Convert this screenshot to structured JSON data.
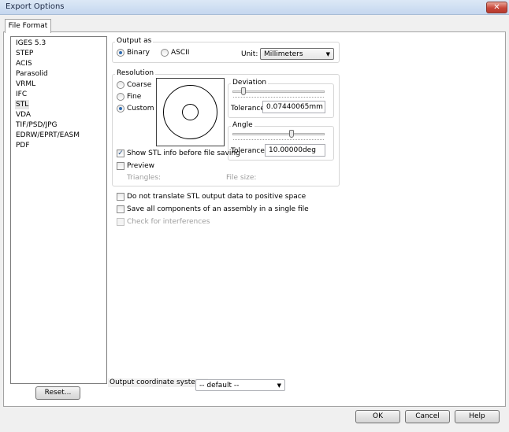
{
  "window": {
    "title": "Export Options",
    "close_glyph": "✕"
  },
  "tabs": [
    {
      "label": "File Format"
    }
  ],
  "formats": [
    {
      "label": "IGES 5.3"
    },
    {
      "label": "STEP"
    },
    {
      "label": "ACIS"
    },
    {
      "label": "Parasolid"
    },
    {
      "label": "VRML"
    },
    {
      "label": "IFC"
    },
    {
      "label": "STL"
    },
    {
      "label": "VDA"
    },
    {
      "label": "TIF/PSD/JPG"
    },
    {
      "label": "EDRW/EPRT/EASM"
    },
    {
      "label": "PDF"
    }
  ],
  "selected_format": "STL",
  "output_as": {
    "legend": "Output as",
    "binary_label": "Binary",
    "ascii_label": "ASCII",
    "selected": "Binary",
    "unit_label": "Unit:",
    "unit_value": "Millimeters"
  },
  "resolution": {
    "legend": "Resolution",
    "coarse_label": "Coarse",
    "fine_label": "Fine",
    "custom_label": "Custom",
    "selected": "Custom",
    "deviation": {
      "legend": "Deviation",
      "tolerance_label": "Tolerance:",
      "tolerance_value": "0.07440065mm",
      "slider_level": 0.1
    },
    "angle": {
      "legend": "Angle",
      "tolerance_label": "Tolerance:",
      "tolerance_value": "10.00000deg",
      "slider_level": 0.65
    },
    "show_stl_info_label": "Show STL info before file saving",
    "show_stl_info_checked": true,
    "preview_label": "Preview",
    "preview_checked": false,
    "triangles_label": "Triangles:",
    "file_size_label": "File size:"
  },
  "options": {
    "no_translate_label": "Do not translate STL output data to positive space",
    "save_all_label": "Save all components of an assembly in a single file",
    "check_interferences_label": "Check for interferences"
  },
  "output_coordinate_system": {
    "label": "Output coordinate system:",
    "value": "-- default --"
  },
  "buttons": {
    "reset": "Reset...",
    "ok": "OK",
    "cancel": "Cancel",
    "help": "Help"
  },
  "check_glyph": "✓",
  "arrow_glyph": "▼"
}
